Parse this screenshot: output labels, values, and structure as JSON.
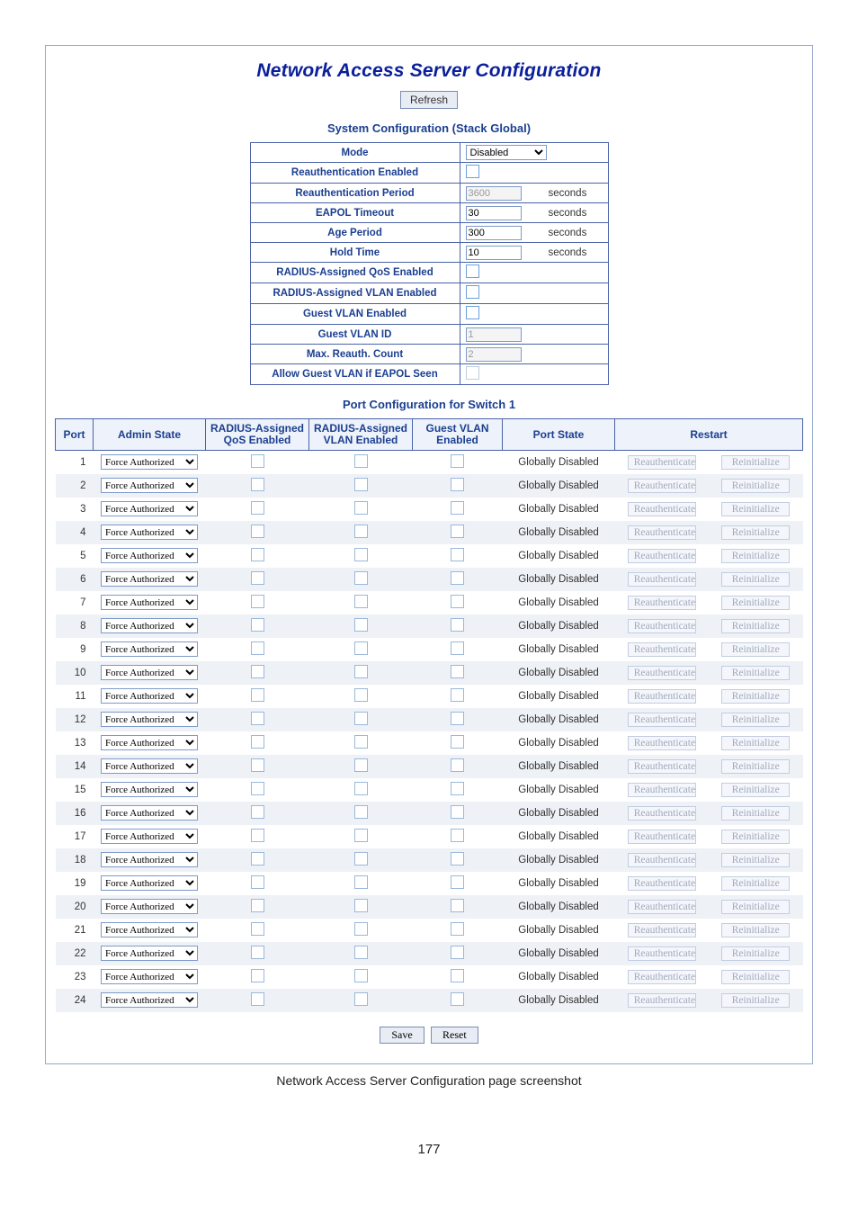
{
  "page_number": "177",
  "caption": "Network Access Server Configuration page screenshot",
  "title": "Network Access Server Configuration",
  "refresh_label": "Refresh",
  "sys_subtitle": "System Configuration (Stack Global)",
  "port_subtitle": "Port Configuration for Switch 1",
  "buttons": {
    "save": "Save",
    "reset": "Reset"
  },
  "sys": {
    "mode_label": "Mode",
    "mode_value": "Disabled",
    "reauth_enabled_label": "Reauthentication Enabled",
    "reauth_period_label": "Reauthentication Period",
    "reauth_period_value": "3600",
    "seconds": "seconds",
    "eapol_label": "EAPOL Timeout",
    "eapol_value": "30",
    "age_label": "Age Period",
    "age_value": "300",
    "hold_label": "Hold Time",
    "hold_value": "10",
    "radius_qos_label": "RADIUS-Assigned QoS Enabled",
    "radius_vlan_label": "RADIUS-Assigned VLAN Enabled",
    "guest_vlan_enabled_label": "Guest VLAN Enabled",
    "guest_vlan_id_label": "Guest VLAN ID",
    "guest_vlan_id_value": "1",
    "max_reauth_label": "Max. Reauth. Count",
    "max_reauth_value": "2",
    "allow_guest_label": "Allow Guest VLAN if EAPOL Seen"
  },
  "headers": {
    "port": "Port",
    "admin": "Admin State",
    "qos": "RADIUS-Assigned QoS Enabled",
    "vlan": "RADIUS-Assigned VLAN Enabled",
    "gvlan": "Guest VLAN Enabled",
    "pstate": "Port State",
    "restart": "Restart"
  },
  "row_defaults": {
    "admin_state": "Force Authorized",
    "port_state": "Globally Disabled",
    "reauth_btn": "Reauthenticate",
    "reinit_btn": "Reinitialize"
  },
  "ports": [
    {
      "n": "1"
    },
    {
      "n": "2"
    },
    {
      "n": "3"
    },
    {
      "n": "4"
    },
    {
      "n": "5"
    },
    {
      "n": "6"
    },
    {
      "n": "7"
    },
    {
      "n": "8"
    },
    {
      "n": "9"
    },
    {
      "n": "10"
    },
    {
      "n": "11"
    },
    {
      "n": "12"
    },
    {
      "n": "13"
    },
    {
      "n": "14"
    },
    {
      "n": "15"
    },
    {
      "n": "16"
    },
    {
      "n": "17"
    },
    {
      "n": "18"
    },
    {
      "n": "19"
    },
    {
      "n": "20"
    },
    {
      "n": "21"
    },
    {
      "n": "22"
    },
    {
      "n": "23"
    },
    {
      "n": "24"
    }
  ]
}
